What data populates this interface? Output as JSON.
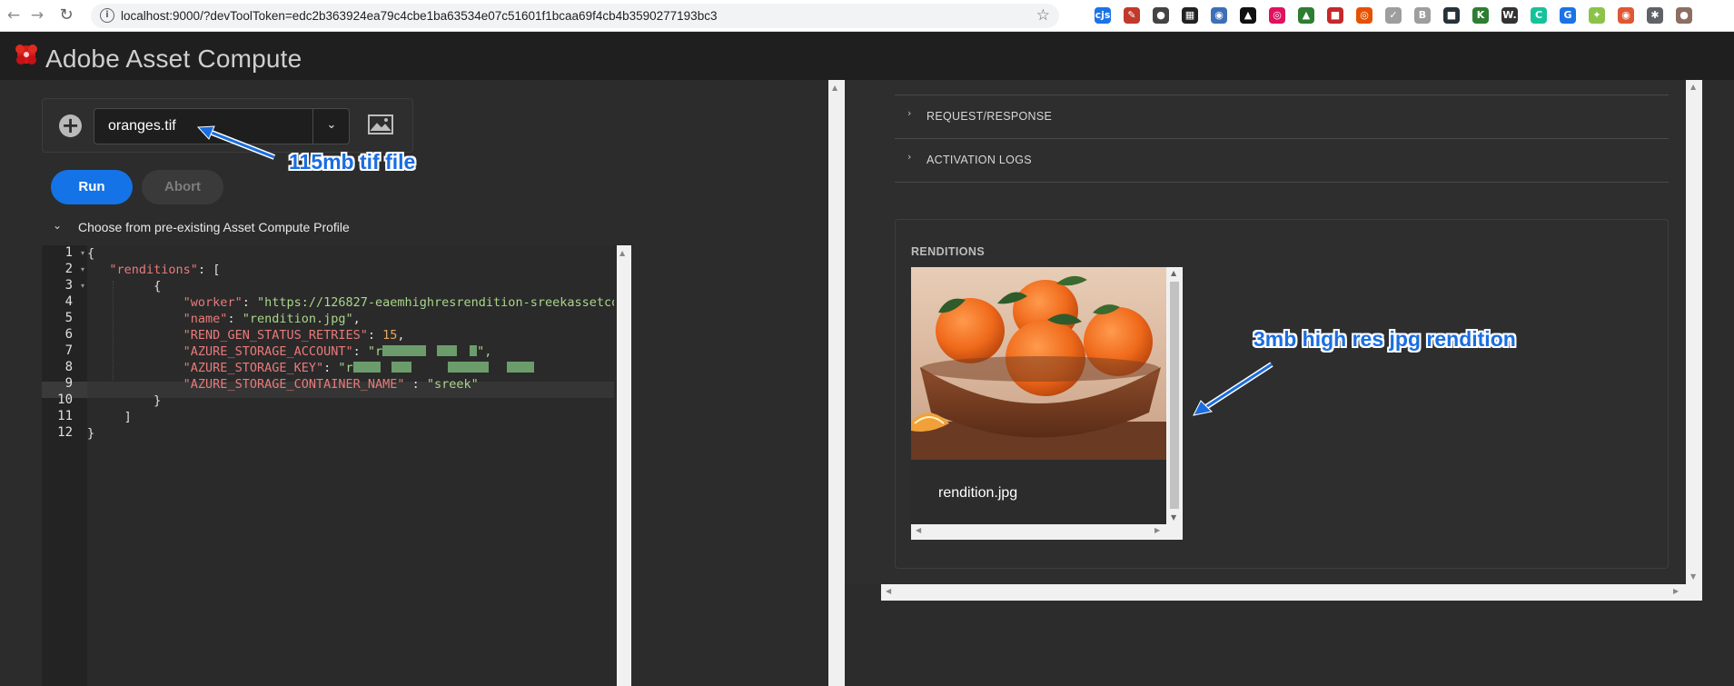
{
  "browser": {
    "url": "localhost:9000/?devToolToken=edc2b363924ea79c4cbe1ba63534e07c51601f1bcaa69f4cb4b3590277193bc3",
    "back_icon": "arrow-left-icon",
    "forward_icon": "arrow-right-icon",
    "reload_icon": "reload-icon",
    "info_icon": "info-icon",
    "bookmark_icon": "star-icon",
    "extensions": [
      {
        "label": "cjs",
        "color": "#1a73e8"
      },
      {
        "label": "✎",
        "color": "#c0392b"
      },
      {
        "label": "●",
        "color": "#444444"
      },
      {
        "label": "▦",
        "color": "#222222"
      },
      {
        "label": "◉",
        "color": "#3d6fb8"
      },
      {
        "label": "▲",
        "color": "#111111"
      },
      {
        "label": "◎",
        "color": "#e0115f"
      },
      {
        "label": "▲",
        "color": "#2e7d32"
      },
      {
        "label": "■",
        "color": "#c62828"
      },
      {
        "label": "◎",
        "color": "#e65100"
      },
      {
        "label": "✓",
        "color": "#9e9e9e"
      },
      {
        "label": "B",
        "color": "#9e9e9e"
      },
      {
        "label": "■",
        "color": "#263238"
      },
      {
        "label": "K",
        "color": "#2e7d32"
      },
      {
        "label": "W.",
        "color": "#333333"
      },
      {
        "label": "C",
        "color": "#15c39a"
      },
      {
        "label": "G",
        "color": "#1a73e8"
      },
      {
        "label": "✦",
        "color": "#8bc34a"
      },
      {
        "label": "◉",
        "color": "#de5833"
      },
      {
        "label": "✱",
        "color": "#5f6368"
      },
      {
        "label": "●",
        "color": "#8d6e63"
      }
    ]
  },
  "app": {
    "title": "Adobe Asset Compute",
    "logo_icon": "adobe-logo-icon"
  },
  "file_picker": {
    "add_icon": "plus-circle-icon",
    "selected_file": "oranges.tif",
    "dropdown_icon": "chevron-down-icon",
    "preview_icon": "image-icon"
  },
  "actions": {
    "run_label": "Run",
    "abort_label": "Abort"
  },
  "profile": {
    "toggle_label": "Choose from pre-existing Asset Compute Profile",
    "toggle_icon": "chevron-down-icon"
  },
  "editor": {
    "line_numbers": [
      "1",
      "2",
      "3",
      "4",
      "5",
      "6",
      "7",
      "8",
      "9",
      "10",
      "11",
      "12"
    ],
    "lines": {
      "l1": "{",
      "l2_key": "\"renditions\"",
      "l2_rest": ": [",
      "l3": "{",
      "l4_key": "\"worker\"",
      "l4_val": "\"https://126827-eaemhighresrendition-sreekassetco",
      "l5_key": "\"name\"",
      "l5_val": "\"rendition.jpg\"",
      "l6_key": "\"REND_GEN_STATUS_RETRIES\"",
      "l6_val": "15",
      "l7_key": "\"AZURE_STORAGE_ACCOUNT\"",
      "l7_pre": "\"r",
      "l8_key": "\"AZURE_STORAGE_KEY\"",
      "l8_pre": "\"r",
      "l9_key": "\"AZURE_STORAGE_CONTAINER_NAME\"",
      "l9_val": "\"sreek\"",
      "l10": "}",
      "l11": "]",
      "l12": "}"
    }
  },
  "details": {
    "request_response_label": "REQUEST/RESPONSE",
    "activation_logs_label": "ACTIVATION LOGS"
  },
  "renditions": {
    "header": "RENDITIONS",
    "items": [
      {
        "filename": "rendition.jpg"
      }
    ]
  },
  "annotations": {
    "source_note": "115mb tif file",
    "rendition_note": "3mb high res jpg rendition"
  }
}
